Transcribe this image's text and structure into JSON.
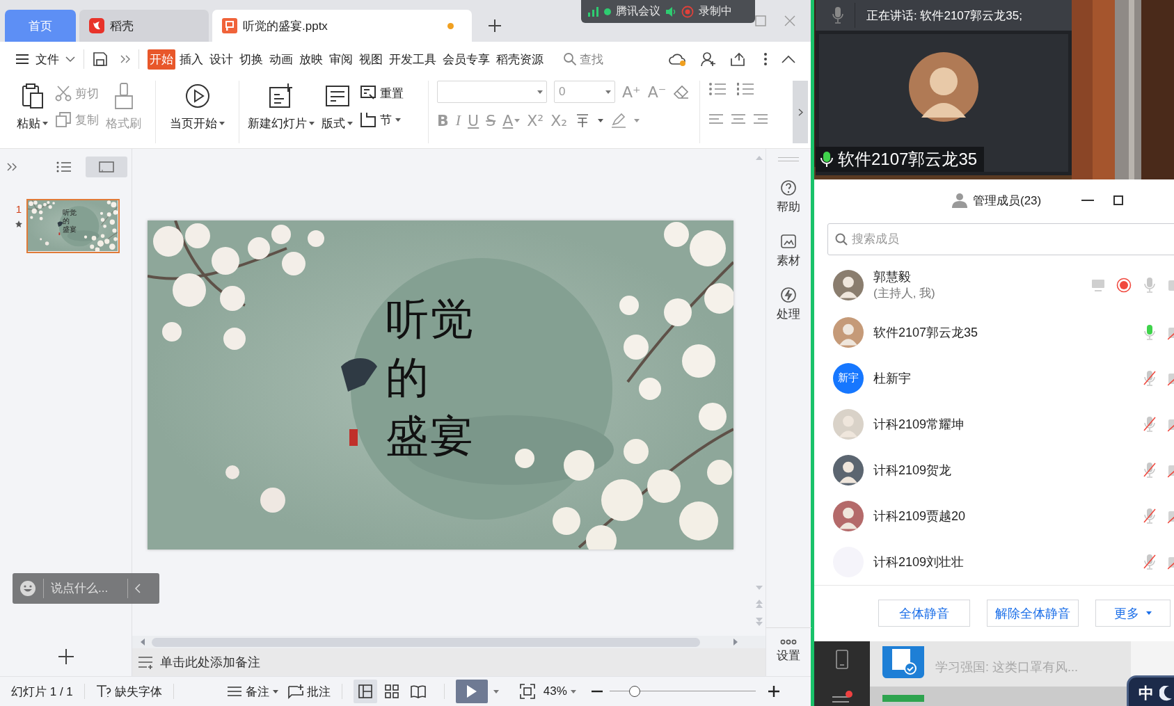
{
  "tabs": [
    {
      "kind": "home",
      "label": "首页",
      "selected": false
    },
    {
      "kind": "docer",
      "label": "稻壳",
      "selected": false
    },
    {
      "kind": "file",
      "label": "听觉的盛宴.pptx",
      "selected": true,
      "unsaved": true
    }
  ],
  "meeting_bar": {
    "app": "腾讯会议",
    "recording": "录制中"
  },
  "menu": {
    "file": "文件",
    "tabs": [
      {
        "label": "开始",
        "selected": true
      },
      {
        "label": "插入",
        "selected": false
      },
      {
        "label": "设计",
        "selected": false
      },
      {
        "label": "切换",
        "selected": false
      },
      {
        "label": "动画",
        "selected": false
      },
      {
        "label": "放映",
        "selected": false
      },
      {
        "label": "审阅",
        "selected": false
      },
      {
        "label": "视图",
        "selected": false
      },
      {
        "label": "开发工具",
        "selected": false
      },
      {
        "label": "会员专享",
        "selected": false
      },
      {
        "label": "稻壳资源",
        "selected": false
      }
    ],
    "search": "查找"
  },
  "ribbon": {
    "paste": {
      "label": "粘贴",
      "disabled": false
    },
    "cut": {
      "label": "剪切",
      "disabled": true
    },
    "copy": {
      "label": "复制",
      "disabled": true
    },
    "format_painter": {
      "label": "格式刷",
      "disabled": true
    },
    "play": {
      "label": "当页开始",
      "disabled": false
    },
    "new_slide": {
      "label": "新建幻灯片",
      "disabled": false
    },
    "layout": {
      "label": "版式",
      "disabled": false
    },
    "reset": {
      "label": "重置",
      "disabled": false
    },
    "section": {
      "label": "节",
      "disabled": false
    },
    "font_size": "0",
    "size_buttons": [
      "A⁺",
      "A⁻"
    ],
    "format_buttons": [
      "B",
      "I",
      "U",
      "S",
      "A",
      "X²",
      "X₂"
    ]
  },
  "slides_panel": {
    "views": [
      {
        "kind": "outline",
        "selected": false
      },
      {
        "kind": "slides",
        "selected": true
      }
    ],
    "thumbnails": [
      {
        "number": "1",
        "selected": true,
        "lines": [
          "听觉",
          "的",
          "盛宴"
        ]
      }
    ],
    "comment_placeholder": "说点什么..."
  },
  "slide": {
    "lines": [
      "听觉",
      "的",
      "盛宴"
    ]
  },
  "side_tools": [
    {
      "kind": "help",
      "label": "帮助"
    },
    {
      "kind": "material",
      "label": "素材"
    },
    {
      "kind": "process",
      "label": "处理"
    },
    {
      "kind": "settings",
      "label": "设置"
    }
  ],
  "notes_placeholder": "单击此处添加备注",
  "status_bar": {
    "slide_count": "幻灯片 1 / 1",
    "missing_fonts": "缺失字体",
    "notes": "备注",
    "comments": "批注",
    "views": [
      {
        "kind": "normal",
        "selected": true
      },
      {
        "kind": "sorter",
        "selected": false
      },
      {
        "kind": "reading",
        "selected": false
      }
    ],
    "zoom": "43%",
    "zoom_slider": {
      "level": 0.17
    }
  },
  "meeting": {
    "speaking": "正在讲话: 软件2107郭云龙35;",
    "video_name": "软件2107郭云龙35",
    "members_title": "管理成员(23)",
    "search_placeholder": "搜索成员",
    "members": [
      {
        "name": "郭慧毅",
        "role": "(主持人, 我)",
        "recording": true,
        "speaking": false,
        "muted": false,
        "camera_off": false
      },
      {
        "name": "软件2107郭云龙35",
        "recording": false,
        "speaking": true,
        "muted": false,
        "camera_off": true
      },
      {
        "name": "杜新宇",
        "avatar": {
          "kind": "initials",
          "text": "新宇"
        },
        "recording": false,
        "speaking": false,
        "muted": true,
        "camera_off": true
      },
      {
        "name": "计科2109常耀坤",
        "recording": false,
        "speaking": false,
        "muted": true,
        "camera_off": true
      },
      {
        "name": "计科2109贺龙",
        "recording": false,
        "speaking": false,
        "muted": true,
        "camera_off": true
      },
      {
        "name": "计科2109贾越20",
        "recording": false,
        "speaking": false,
        "muted": true,
        "camera_off": true
      },
      {
        "name": "计科2109刘壮壮",
        "avatar": {
          "kind": "blank"
        },
        "recording": false,
        "speaking": false,
        "muted": true,
        "camera_off": true
      }
    ],
    "buttons": [
      "全体静音",
      "解除全体静音",
      "更多"
    ]
  },
  "chat": {
    "preview": "学习强国: 这类口罩有风..."
  },
  "ime": "中"
}
